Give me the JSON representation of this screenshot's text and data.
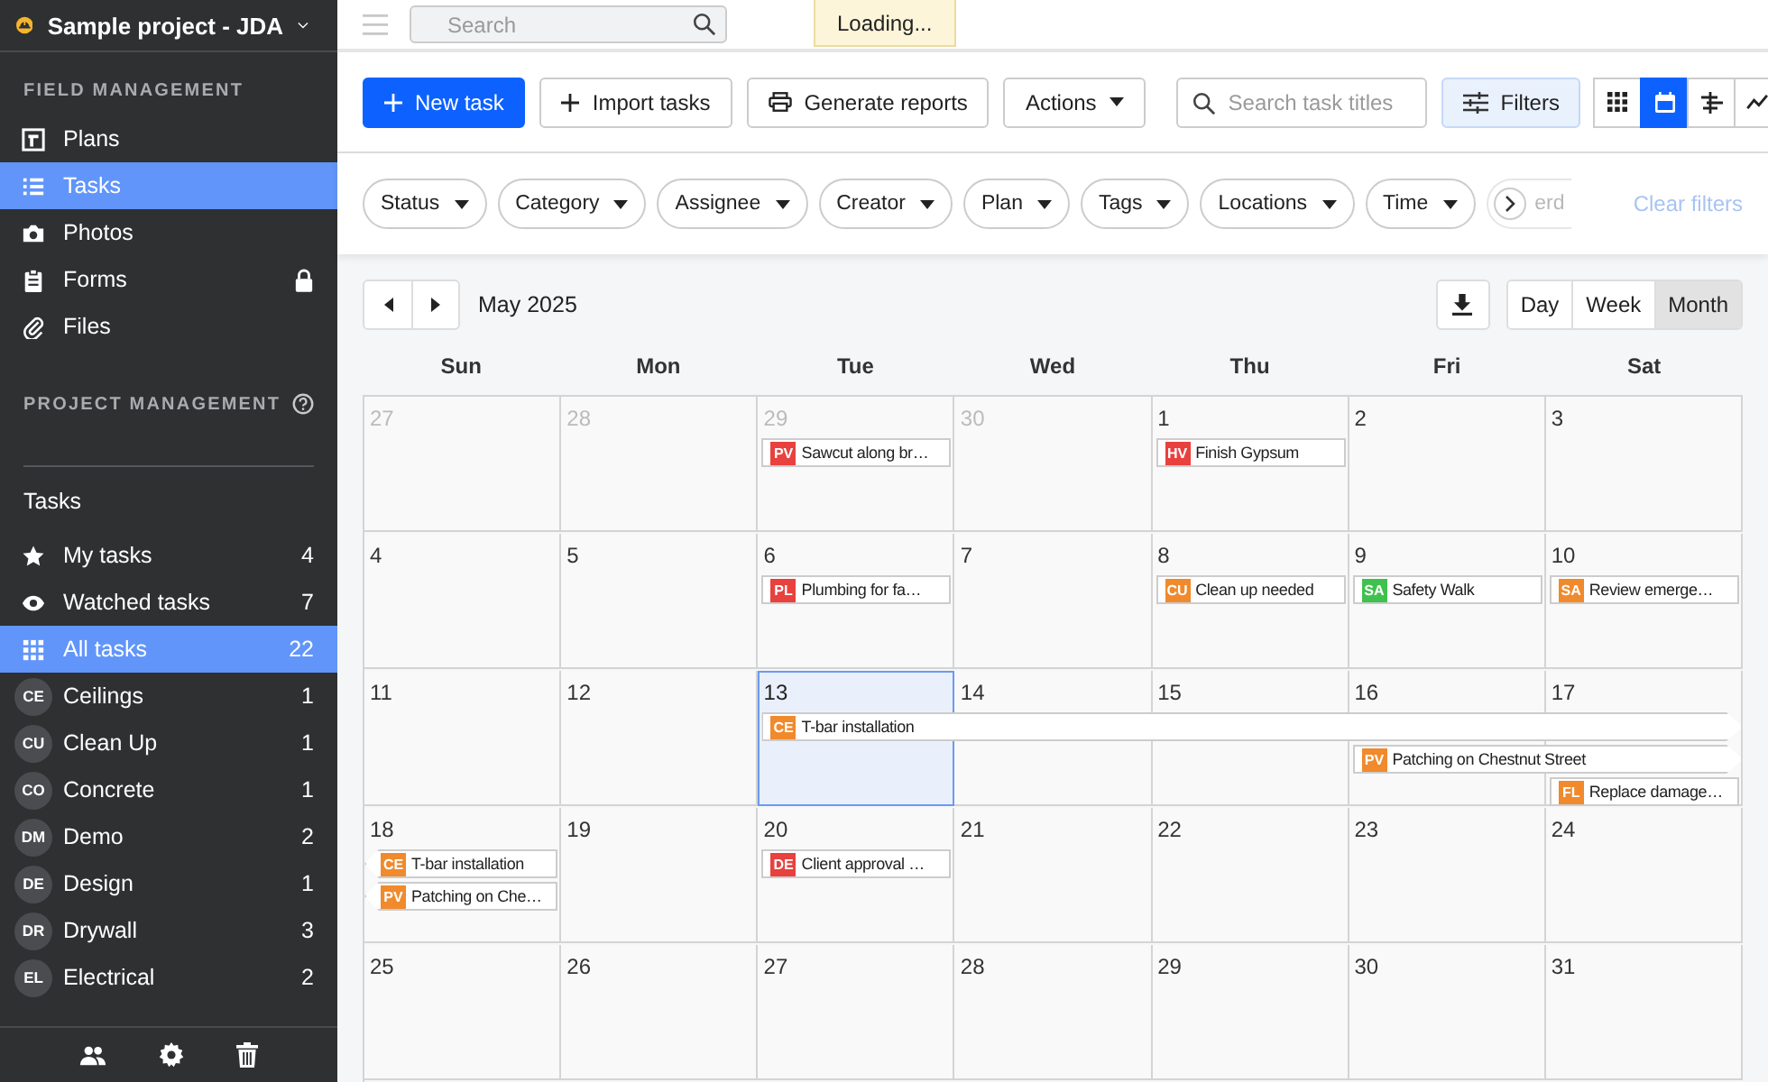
{
  "sidebar": {
    "project": "Sample project - JDA",
    "field_heading": "FIELD MANAGEMENT",
    "field_items": [
      {
        "label": "Plans",
        "selected": false,
        "locked": false
      },
      {
        "label": "Tasks",
        "selected": true,
        "locked": false
      },
      {
        "label": "Photos",
        "selected": false,
        "locked": false
      },
      {
        "label": "Forms",
        "selected": false,
        "locked": true
      },
      {
        "label": "Files",
        "selected": false,
        "locked": false
      }
    ],
    "project_heading": "PROJECT MANAGEMENT",
    "tasks_heading": "Tasks",
    "task_lists": [
      {
        "label": "My tasks",
        "count": "4",
        "selected": false
      },
      {
        "label": "Watched tasks",
        "count": "7",
        "selected": false
      },
      {
        "label": "All tasks",
        "count": "22",
        "selected": true
      }
    ],
    "categories": [
      {
        "code": "CE",
        "label": "Ceilings",
        "count": "1"
      },
      {
        "code": "CU",
        "label": "Clean Up",
        "count": "1"
      },
      {
        "code": "CO",
        "label": "Concrete",
        "count": "1"
      },
      {
        "code": "DM",
        "label": "Demo",
        "count": "2"
      },
      {
        "code": "DE",
        "label": "Design",
        "count": "1"
      },
      {
        "code": "DR",
        "label": "Drywall",
        "count": "3"
      },
      {
        "code": "EL",
        "label": "Electrical",
        "count": "2"
      }
    ]
  },
  "topbar": {
    "search": {
      "placeholder": "Search"
    },
    "notice": "Loading..."
  },
  "toolbar": {
    "new_task": "New task",
    "import": "Import tasks",
    "reports": "Generate reports",
    "actions": "Actions",
    "search": {
      "placeholder": "Search task titles"
    },
    "filters": "Filters",
    "views": [
      {
        "selected": false
      },
      {
        "selected": true
      },
      {
        "selected": false
      },
      {
        "selected": false
      }
    ]
  },
  "filter_chips": [
    "Status",
    "Category",
    "Assignee",
    "Creator",
    "Plan",
    "Tags",
    "Locations",
    "Time",
    "erd"
  ],
  "clear_filters": "Clear filters",
  "calendar": {
    "month": "May 2025",
    "ranges": [
      {
        "label": "Day",
        "selected": false
      },
      {
        "label": "Week",
        "selected": false
      },
      {
        "label": "Month",
        "selected": true
      }
    ],
    "weekdays": [
      "Sun",
      "Mon",
      "Tue",
      "Wed",
      "Thu",
      "Fri",
      "Sat"
    ],
    "weeks": [
      {
        "days": [
          {
            "date": "27",
            "faded": true,
            "selected": false
          },
          {
            "date": "28",
            "faded": true,
            "selected": false
          },
          {
            "date": "29",
            "faded": true,
            "selected": false,
            "events": [
              {
                "kind": "task",
                "code": "PV",
                "color": "#e8413e",
                "title": "Sawcut along br…",
                "continues_before": false,
                "continues_after": false
              }
            ]
          },
          {
            "date": "30",
            "faded": true,
            "selected": false
          },
          {
            "date": "1",
            "faded": false,
            "selected": false,
            "events": [
              {
                "kind": "task",
                "code": "HV",
                "color": "#e8413e",
                "title": "Finish Gypsum",
                "continues_before": false,
                "continues_after": false
              }
            ]
          },
          {
            "date": "2",
            "faded": false,
            "selected": false
          },
          {
            "date": "3",
            "faded": false,
            "selected": false
          }
        ]
      },
      {
        "days": [
          {
            "date": "4",
            "faded": false,
            "selected": false
          },
          {
            "date": "5",
            "faded": false,
            "selected": false
          },
          {
            "date": "6",
            "faded": false,
            "selected": false,
            "events": [
              {
                "kind": "task",
                "code": "PL",
                "color": "#e8413e",
                "title": "Plumbing for fa…",
                "continues_before": false,
                "continues_after": false
              }
            ]
          },
          {
            "date": "7",
            "faded": false,
            "selected": false
          },
          {
            "date": "8",
            "faded": false,
            "selected": false,
            "events": [
              {
                "kind": "task",
                "code": "CU",
                "color": "#f08a2c",
                "title": "Clean up needed",
                "continues_before": false,
                "continues_after": false
              }
            ]
          },
          {
            "date": "9",
            "faded": false,
            "selected": false,
            "events": [
              {
                "kind": "task",
                "code": "SA",
                "color": "#3fc14f",
                "title": "Safety Walk",
                "continues_before": false,
                "continues_after": false
              }
            ]
          },
          {
            "date": "10",
            "faded": false,
            "selected": false,
            "events": [
              {
                "kind": "task",
                "code": "SA",
                "color": "#f08a2c",
                "title": "Review emerge…",
                "continues_before": false,
                "continues_after": false
              }
            ]
          }
        ]
      },
      {
        "days": [
          {
            "date": "11",
            "faded": false,
            "selected": false
          },
          {
            "date": "12",
            "faded": false,
            "selected": false
          },
          {
            "date": "13",
            "faded": false,
            "selected": true,
            "events": [
              {
                "kind": "task",
                "code": "CE",
                "color": "#f08a2c",
                "title": "T-bar installation",
                "continues_before": false,
                "continues_after": true
              }
            ]
          },
          {
            "date": "14",
            "faded": false,
            "selected": false,
            "events": [
              {
                "kind": "continuation"
              }
            ]
          },
          {
            "date": "15",
            "faded": false,
            "selected": false,
            "events": [
              {
                "kind": "continuation"
              }
            ]
          },
          {
            "date": "16",
            "faded": false,
            "selected": false,
            "events": [
              {
                "kind": "continuation"
              },
              {
                "kind": "task",
                "code": "PV",
                "color": "#f08a2c",
                "title": "Patching on Chestnut Street",
                "continues_before": false,
                "continues_after": true
              }
            ]
          },
          {
            "date": "17",
            "faded": false,
            "selected": false,
            "events": [
              {
                "kind": "continuation"
              },
              {
                "kind": "continuation"
              },
              {
                "kind": "task",
                "code": "FL",
                "color": "#f08a2c",
                "title": "Replace damage…",
                "continues_before": false,
                "continues_after": false
              }
            ]
          }
        ]
      },
      {
        "days": [
          {
            "date": "18",
            "faded": false,
            "selected": false,
            "events": [
              {
                "kind": "task",
                "code": "CE",
                "color": "#f08a2c",
                "title": "T-bar installation",
                "continues_before": true,
                "continues_after": false
              },
              {
                "kind": "task",
                "code": "PV",
                "color": "#f08a2c",
                "title": "Patching on Che…",
                "continues_before": true,
                "continues_after": false
              }
            ]
          },
          {
            "date": "19",
            "faded": false,
            "selected": false
          },
          {
            "date": "20",
            "faded": false,
            "selected": false,
            "events": [
              {
                "kind": "task",
                "code": "DE",
                "color": "#e8413e",
                "title": "Client approval …",
                "continues_before": false,
                "continues_after": false
              }
            ]
          },
          {
            "date": "21",
            "faded": false,
            "selected": false
          },
          {
            "date": "22",
            "faded": false,
            "selected": false
          },
          {
            "date": "23",
            "faded": false,
            "selected": false
          },
          {
            "date": "24",
            "faded": false,
            "selected": false
          }
        ]
      },
      {
        "days": [
          {
            "date": "25",
            "faded": false,
            "selected": false
          },
          {
            "date": "26",
            "faded": false,
            "selected": false
          },
          {
            "date": "27",
            "faded": false,
            "selected": false
          },
          {
            "date": "28",
            "faded": false,
            "selected": false
          },
          {
            "date": "29",
            "faded": false,
            "selected": false
          },
          {
            "date": "30",
            "faded": false,
            "selected": false
          },
          {
            "date": "31",
            "faded": false,
            "selected": false
          }
        ]
      }
    ]
  }
}
